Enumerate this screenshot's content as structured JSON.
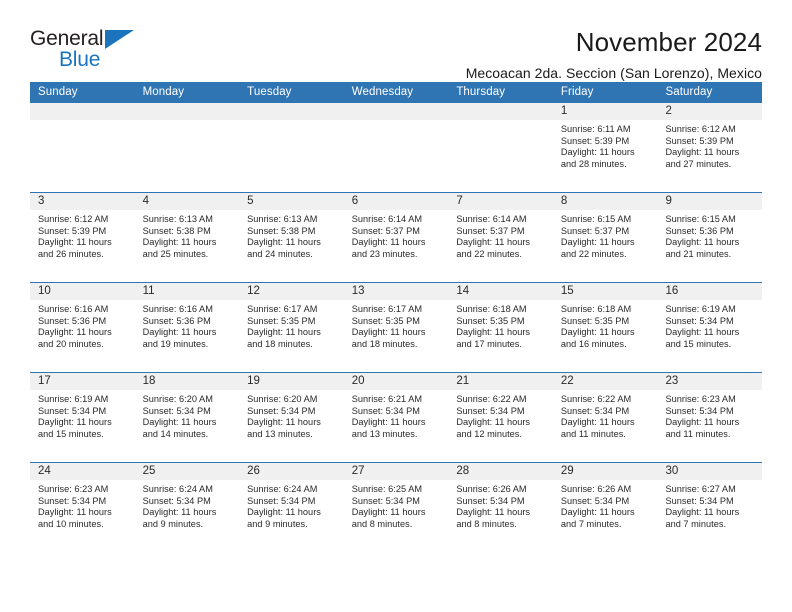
{
  "logo": {
    "word_primary": "General",
    "word_secondary": "Blue",
    "primary_color": "#231f20",
    "accent_color": "#1c75bc"
  },
  "header": {
    "title": "November 2024",
    "subtitle": "Mecoacan 2da. Seccion (San Lorenzo), Mexico"
  },
  "theme": {
    "header_blue": "#3075b3",
    "date_strip_gray": "#f0f0f0",
    "text_color": "#2a2a2a"
  },
  "calendar": {
    "weekdays": [
      "Sunday",
      "Monday",
      "Tuesday",
      "Wednesday",
      "Thursday",
      "Friday",
      "Saturday"
    ],
    "weeks": [
      [
        {
          "day": "",
          "sunrise": "",
          "sunset": "",
          "daylight_line1": "",
          "daylight_line2": ""
        },
        {
          "day": "",
          "sunrise": "",
          "sunset": "",
          "daylight_line1": "",
          "daylight_line2": ""
        },
        {
          "day": "",
          "sunrise": "",
          "sunset": "",
          "daylight_line1": "",
          "daylight_line2": ""
        },
        {
          "day": "",
          "sunrise": "",
          "sunset": "",
          "daylight_line1": "",
          "daylight_line2": ""
        },
        {
          "day": "",
          "sunrise": "",
          "sunset": "",
          "daylight_line1": "",
          "daylight_line2": ""
        },
        {
          "day": "1",
          "sunrise": "Sunrise: 6:11 AM",
          "sunset": "Sunset: 5:39 PM",
          "daylight_line1": "Daylight: 11 hours",
          "daylight_line2": "and 28 minutes."
        },
        {
          "day": "2",
          "sunrise": "Sunrise: 6:12 AM",
          "sunset": "Sunset: 5:39 PM",
          "daylight_line1": "Daylight: 11 hours",
          "daylight_line2": "and 27 minutes."
        }
      ],
      [
        {
          "day": "3",
          "sunrise": "Sunrise: 6:12 AM",
          "sunset": "Sunset: 5:39 PM",
          "daylight_line1": "Daylight: 11 hours",
          "daylight_line2": "and 26 minutes."
        },
        {
          "day": "4",
          "sunrise": "Sunrise: 6:13 AM",
          "sunset": "Sunset: 5:38 PM",
          "daylight_line1": "Daylight: 11 hours",
          "daylight_line2": "and 25 minutes."
        },
        {
          "day": "5",
          "sunrise": "Sunrise: 6:13 AM",
          "sunset": "Sunset: 5:38 PM",
          "daylight_line1": "Daylight: 11 hours",
          "daylight_line2": "and 24 minutes."
        },
        {
          "day": "6",
          "sunrise": "Sunrise: 6:14 AM",
          "sunset": "Sunset: 5:37 PM",
          "daylight_line1": "Daylight: 11 hours",
          "daylight_line2": "and 23 minutes."
        },
        {
          "day": "7",
          "sunrise": "Sunrise: 6:14 AM",
          "sunset": "Sunset: 5:37 PM",
          "daylight_line1": "Daylight: 11 hours",
          "daylight_line2": "and 22 minutes."
        },
        {
          "day": "8",
          "sunrise": "Sunrise: 6:15 AM",
          "sunset": "Sunset: 5:37 PM",
          "daylight_line1": "Daylight: 11 hours",
          "daylight_line2": "and 22 minutes."
        },
        {
          "day": "9",
          "sunrise": "Sunrise: 6:15 AM",
          "sunset": "Sunset: 5:36 PM",
          "daylight_line1": "Daylight: 11 hours",
          "daylight_line2": "and 21 minutes."
        }
      ],
      [
        {
          "day": "10",
          "sunrise": "Sunrise: 6:16 AM",
          "sunset": "Sunset: 5:36 PM",
          "daylight_line1": "Daylight: 11 hours",
          "daylight_line2": "and 20 minutes."
        },
        {
          "day": "11",
          "sunrise": "Sunrise: 6:16 AM",
          "sunset": "Sunset: 5:36 PM",
          "daylight_line1": "Daylight: 11 hours",
          "daylight_line2": "and 19 minutes."
        },
        {
          "day": "12",
          "sunrise": "Sunrise: 6:17 AM",
          "sunset": "Sunset: 5:35 PM",
          "daylight_line1": "Daylight: 11 hours",
          "daylight_line2": "and 18 minutes."
        },
        {
          "day": "13",
          "sunrise": "Sunrise: 6:17 AM",
          "sunset": "Sunset: 5:35 PM",
          "daylight_line1": "Daylight: 11 hours",
          "daylight_line2": "and 18 minutes."
        },
        {
          "day": "14",
          "sunrise": "Sunrise: 6:18 AM",
          "sunset": "Sunset: 5:35 PM",
          "daylight_line1": "Daylight: 11 hours",
          "daylight_line2": "and 17 minutes."
        },
        {
          "day": "15",
          "sunrise": "Sunrise: 6:18 AM",
          "sunset": "Sunset: 5:35 PM",
          "daylight_line1": "Daylight: 11 hours",
          "daylight_line2": "and 16 minutes."
        },
        {
          "day": "16",
          "sunrise": "Sunrise: 6:19 AM",
          "sunset": "Sunset: 5:34 PM",
          "daylight_line1": "Daylight: 11 hours",
          "daylight_line2": "and 15 minutes."
        }
      ],
      [
        {
          "day": "17",
          "sunrise": "Sunrise: 6:19 AM",
          "sunset": "Sunset: 5:34 PM",
          "daylight_line1": "Daylight: 11 hours",
          "daylight_line2": "and 15 minutes."
        },
        {
          "day": "18",
          "sunrise": "Sunrise: 6:20 AM",
          "sunset": "Sunset: 5:34 PM",
          "daylight_line1": "Daylight: 11 hours",
          "daylight_line2": "and 14 minutes."
        },
        {
          "day": "19",
          "sunrise": "Sunrise: 6:20 AM",
          "sunset": "Sunset: 5:34 PM",
          "daylight_line1": "Daylight: 11 hours",
          "daylight_line2": "and 13 minutes."
        },
        {
          "day": "20",
          "sunrise": "Sunrise: 6:21 AM",
          "sunset": "Sunset: 5:34 PM",
          "daylight_line1": "Daylight: 11 hours",
          "daylight_line2": "and 13 minutes."
        },
        {
          "day": "21",
          "sunrise": "Sunrise: 6:22 AM",
          "sunset": "Sunset: 5:34 PM",
          "daylight_line1": "Daylight: 11 hours",
          "daylight_line2": "and 12 minutes."
        },
        {
          "day": "22",
          "sunrise": "Sunrise: 6:22 AM",
          "sunset": "Sunset: 5:34 PM",
          "daylight_line1": "Daylight: 11 hours",
          "daylight_line2": "and 11 minutes."
        },
        {
          "day": "23",
          "sunrise": "Sunrise: 6:23 AM",
          "sunset": "Sunset: 5:34 PM",
          "daylight_line1": "Daylight: 11 hours",
          "daylight_line2": "and 11 minutes."
        }
      ],
      [
        {
          "day": "24",
          "sunrise": "Sunrise: 6:23 AM",
          "sunset": "Sunset: 5:34 PM",
          "daylight_line1": "Daylight: 11 hours",
          "daylight_line2": "and 10 minutes."
        },
        {
          "day": "25",
          "sunrise": "Sunrise: 6:24 AM",
          "sunset": "Sunset: 5:34 PM",
          "daylight_line1": "Daylight: 11 hours",
          "daylight_line2": "and 9 minutes."
        },
        {
          "day": "26",
          "sunrise": "Sunrise: 6:24 AM",
          "sunset": "Sunset: 5:34 PM",
          "daylight_line1": "Daylight: 11 hours",
          "daylight_line2": "and 9 minutes."
        },
        {
          "day": "27",
          "sunrise": "Sunrise: 6:25 AM",
          "sunset": "Sunset: 5:34 PM",
          "daylight_line1": "Daylight: 11 hours",
          "daylight_line2": "and 8 minutes."
        },
        {
          "day": "28",
          "sunrise": "Sunrise: 6:26 AM",
          "sunset": "Sunset: 5:34 PM",
          "daylight_line1": "Daylight: 11 hours",
          "daylight_line2": "and 8 minutes."
        },
        {
          "day": "29",
          "sunrise": "Sunrise: 6:26 AM",
          "sunset": "Sunset: 5:34 PM",
          "daylight_line1": "Daylight: 11 hours",
          "daylight_line2": "and 7 minutes."
        },
        {
          "day": "30",
          "sunrise": "Sunrise: 6:27 AM",
          "sunset": "Sunset: 5:34 PM",
          "daylight_line1": "Daylight: 11 hours",
          "daylight_line2": "and 7 minutes."
        }
      ]
    ]
  }
}
